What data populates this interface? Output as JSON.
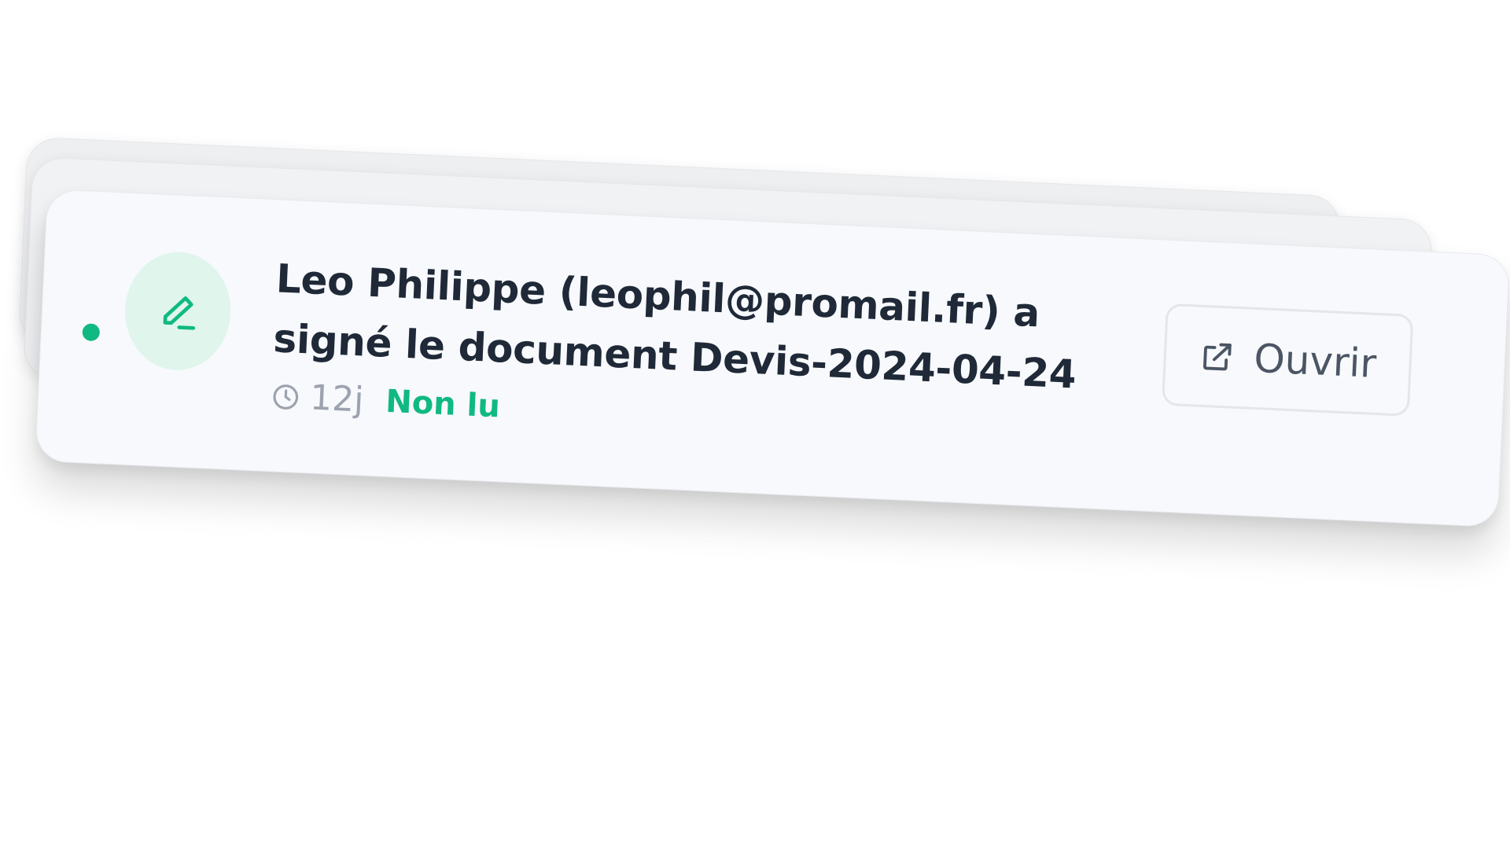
{
  "notification": {
    "message": "Leo Philippe (leophil@promail.fr) a signé le document Devis-2024-04-24",
    "time": "12j",
    "status": "Non lu",
    "action_label": "Ouvrir",
    "icon": "pen-line-icon"
  },
  "colors": {
    "accent": "#10b981",
    "avatar_bg": "#e0f5ec",
    "card_bg": "#f7f9fc",
    "text": "#1f2937",
    "muted": "#9ca3af"
  }
}
